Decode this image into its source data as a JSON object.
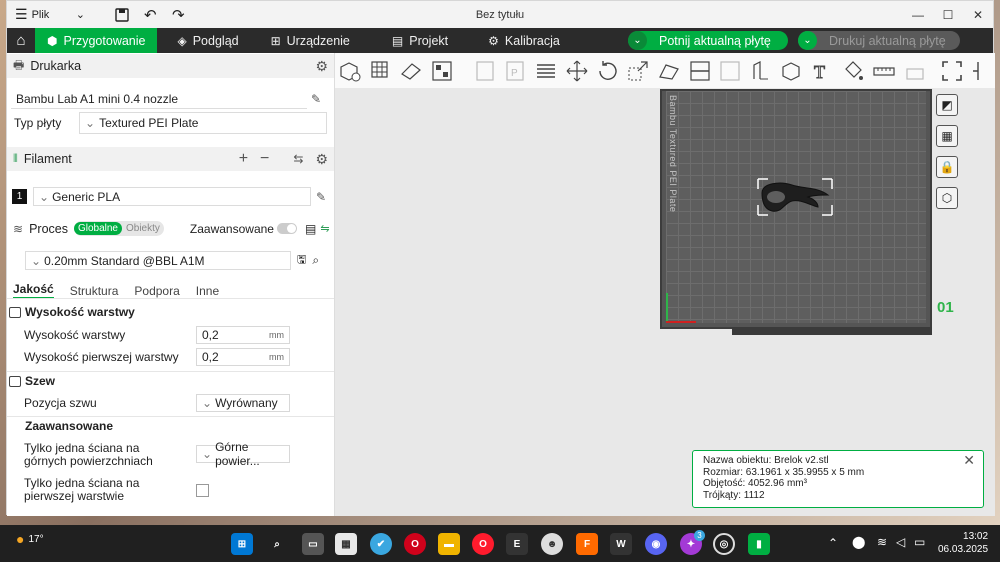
{
  "titlebar": {
    "menu_label": "Plik",
    "title": "Bez tytułu"
  },
  "nav": {
    "tabs": [
      {
        "label": "Przygotowanie",
        "icon": "cube-icon"
      },
      {
        "label": "Podgląd",
        "icon": "layers-icon"
      },
      {
        "label": "Urządzenie",
        "icon": "device-icon"
      },
      {
        "label": "Projekt",
        "icon": "document-icon"
      },
      {
        "label": "Kalibracja",
        "icon": "gear-icon"
      }
    ],
    "slice_label": "Potnij aktualną płytę",
    "print_label": "Drukuj aktualną płytę"
  },
  "printer": {
    "section_label": "Drukarka",
    "name": "Bambu Lab A1 mini 0.4 nozzle",
    "plate_type_label": "Typ płyty",
    "plate_type": "Textured PEI Plate"
  },
  "filament": {
    "section_label": "Filament",
    "slot_number": "1",
    "name": "Generic PLA"
  },
  "process": {
    "section_label": "Proces",
    "toggle_global": "Globalne",
    "toggle_objects": "Obiekty",
    "advanced_label": "Zaawansowane",
    "preset": "0.20mm Standard @BBL A1M",
    "tabs": [
      "Jakość",
      "Struktura",
      "Podpora",
      "Inne"
    ],
    "groups": {
      "layer_height": {
        "title": "Wysokość warstwy",
        "layer_height_label": "Wysokość warstwy",
        "layer_height_value": "0,2",
        "first_layer_label": "Wysokość pierwszej warstwy",
        "first_layer_value": "0,2",
        "unit": "mm"
      },
      "seam": {
        "title": "Szew",
        "position_label": "Pozycja szwu",
        "position_value": "Wyrównany"
      },
      "advanced": {
        "title": "Zaawansowane",
        "single_wall_top_label_1": "Tylko jedna ściana na",
        "single_wall_top_label_2": "górnych powierzchniach",
        "single_wall_top_value": "Górne powier...",
        "single_wall_first_label_1": "Tylko jedna ściana na",
        "single_wall_first_label_2": "pierwszej warstwie"
      }
    }
  },
  "viewport": {
    "plate_label": "Bambu Textured PEI Plate",
    "plate_number": "01",
    "info": {
      "name": "Nazwa obiektu: Brelok v2.stl",
      "size": "Rozmiar: 63.1961 x 35.9955 x 5 mm",
      "volume": "Objętość: 4052.96 mm³",
      "triangles": "Trójkąty: 1112"
    }
  },
  "taskbar": {
    "weather": "17°",
    "time": "13:02",
    "date": "06.03.2025",
    "notification_count": "3"
  },
  "colors": {
    "accent": "#00ae42",
    "navbar": "#2b2b2b",
    "taskbar": "#202020"
  }
}
